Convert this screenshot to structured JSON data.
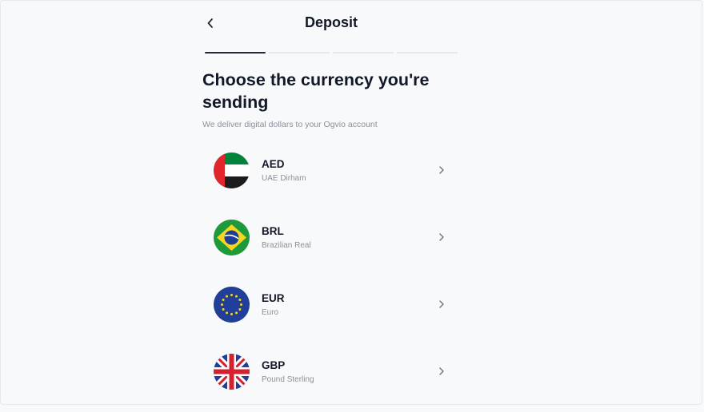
{
  "header": {
    "title": "Deposit"
  },
  "progress": {
    "steps": 4,
    "current": 1
  },
  "heading": "Choose the currency you're sending",
  "subtitle": "We deliver digital dollars to your Ogvio account",
  "currencies": [
    {
      "code": "AED",
      "name": "UAE Dirham",
      "flag_icon": "uae-flag-icon"
    },
    {
      "code": "BRL",
      "name": "Brazilian Real",
      "flag_icon": "brazil-flag-icon"
    },
    {
      "code": "EUR",
      "name": "Euro",
      "flag_icon": "eu-flag-icon"
    },
    {
      "code": "GBP",
      "name": "Pound Sterling",
      "flag_icon": "uk-flag-icon"
    }
  ]
}
